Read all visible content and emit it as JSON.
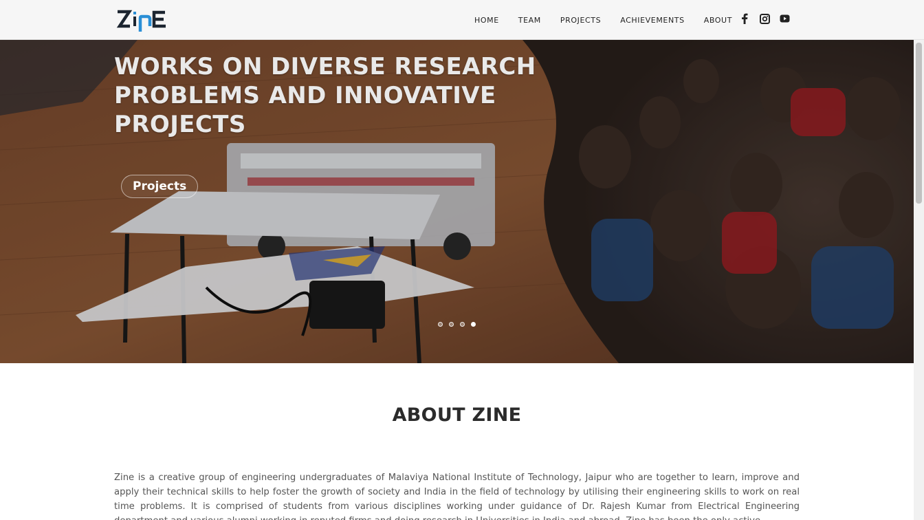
{
  "brand": {
    "logo_text": "ZinE"
  },
  "nav": {
    "items": [
      {
        "label": "HOME"
      },
      {
        "label": "TEAM"
      },
      {
        "label": "PROJECTS"
      },
      {
        "label": "ACHIEVEMENTS"
      },
      {
        "label": "ABOUT"
      }
    ],
    "social": [
      "facebook-icon",
      "instagram-icon",
      "youtube-icon"
    ]
  },
  "hero": {
    "title": "WORKS ON DIVERSE RESEARCH PROBLEMS AND INNOVATIVE PROJECTS",
    "button_label": "Projects",
    "slides_total": 4,
    "active_slide": 4
  },
  "about": {
    "title": "ABOUT ZINE",
    "body": "Zine is a creative group of engineering undergraduates of Malaviya National Institute of Technology, Jaipur who are together to learn, improve and apply their technical skills to help foster the growth of society and India in the field of technology by utilising their engineering skills to work on real time problems. It is comprised of students from various disciplines working under guidance of Dr. Rajesh Kumar from Electrical Engineering department and various alumni working in reputed firms and doing research in Universities in India and abroad. Zine has been the only active"
  },
  "colors": {
    "header_bg": "#f6f6f6",
    "logo_dark": "#1c2530",
    "logo_blue": "#2a8fd6"
  }
}
